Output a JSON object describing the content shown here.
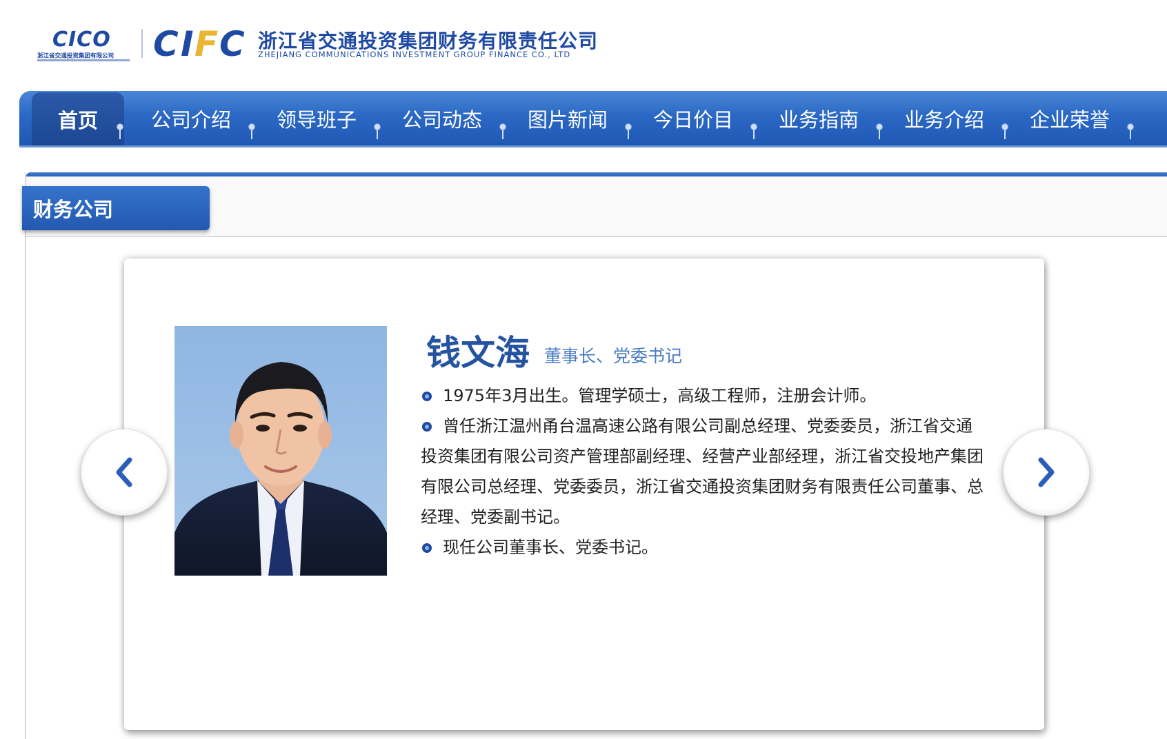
{
  "header": {
    "cico_logo_text": "CICO",
    "cico_logo_subtext": "浙江省交通投资集团有限公司",
    "cifc_letters": [
      "C",
      "I",
      "F",
      "C"
    ],
    "company_name_cn": "浙江省交通投资集团财务有限责任公司",
    "company_name_en": "ZHEJIANG COMMUNICATIONS INVESTMENT GROUP FINANCE CO., LTD"
  },
  "nav": {
    "items": [
      {
        "label": "首页",
        "active": true
      },
      {
        "label": "公司介绍",
        "active": false
      },
      {
        "label": "领导班子",
        "active": false
      },
      {
        "label": "公司动态",
        "active": false
      },
      {
        "label": "图片新闻",
        "active": false
      },
      {
        "label": "今日价目",
        "active": false
      },
      {
        "label": "业务指南",
        "active": false
      },
      {
        "label": "业务介绍",
        "active": false
      },
      {
        "label": "企业荣誉",
        "active": false
      }
    ]
  },
  "section": {
    "tab_label": "财务公司"
  },
  "profile": {
    "name": "钱文海",
    "title": "董事长、党委书记",
    "bio": [
      "1975年3月出生。管理学硕士，高级工程师，注册会计师。",
      "曾任浙江温州甬台温高速公路有限公司副总经理、党委委员，浙江省交通投资集团有限公司资产管理部副经理、经营产业部经理，浙江省交投地产集团有限公司总经理、党委委员，浙江省交通投资集团财务有限责任公司董事、总经理、党委副书记。",
      "现任公司董事长、党委书记。"
    ]
  },
  "carousel": {
    "prev_icon": "chevron-left-icon",
    "next_icon": "chevron-right-icon"
  },
  "colors": {
    "brand_blue": "#1f4aa3",
    "nav_blue": "#2a68c4",
    "logo_accent_yellow": "#e9b533",
    "title_blue": "#4a7bc4"
  }
}
